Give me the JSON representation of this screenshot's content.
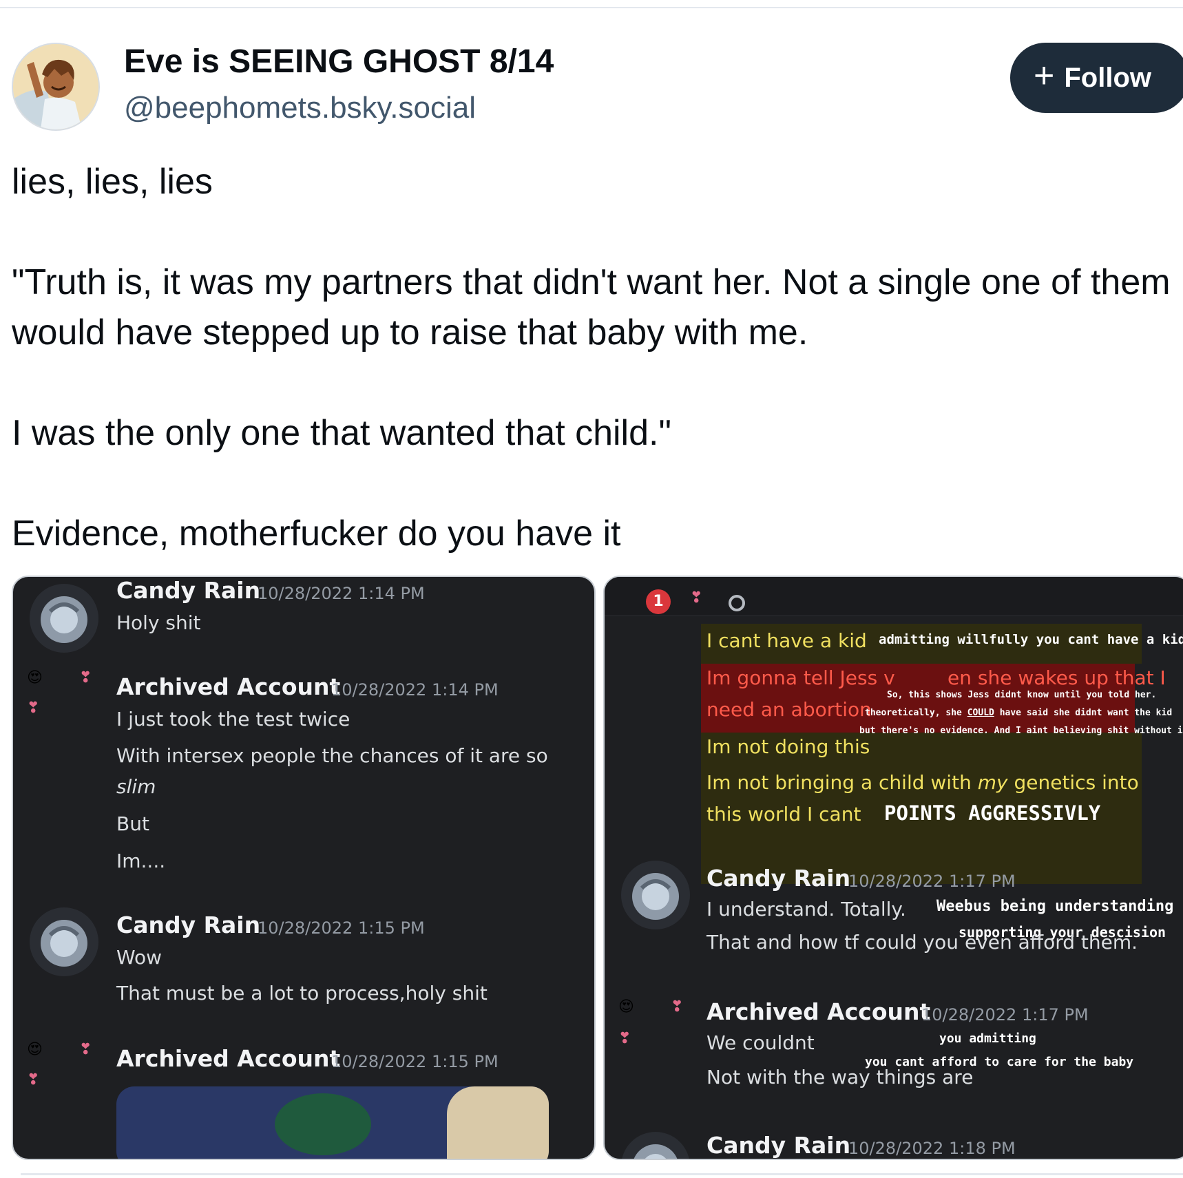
{
  "post": {
    "display_name": "Eve is SEEING GHOST 8/14",
    "handle": "@beephomets.bsky.social",
    "follow_label": "Follow",
    "text": "lies, lies, lies\n\n\"Truth is, it was my partners that didn't want her. Not a single one of them would have stepped up to raise that baby with me.\n\nI was the only one that wanted that child.\"\n\nEvidence, motherfucker do you have it"
  },
  "left_shot": {
    "messages": [
      {
        "user": "Candy Rain",
        "time": "10/28/2022 1:14 PM",
        "lines": [
          "Holy shit"
        ]
      },
      {
        "user": "Archived Account",
        "time": "10/28/2022 1:14 PM",
        "lines": [
          "I just took the test twice",
          "With intersex people the chances of it are so",
          "slim",
          "But",
          "Im...."
        ]
      },
      {
        "user": "Candy Rain",
        "time": "10/28/2022 1:15 PM",
        "lines": [
          "Wow",
          "That must be a lot to process,holy shit"
        ]
      },
      {
        "user": "Archived Account",
        "time": "10/28/2022 1:15 PM",
        "lines": []
      }
    ]
  },
  "right_shot": {
    "badge": "1",
    "highlighted_lines": [
      "I cant have a kid",
      "Im gonna tell Jess v",
      "en she wakes up that I",
      "need an abortion",
      "Im not doing this",
      "Im not bringing a child with",
      "my",
      "genetics into",
      "this world I cant"
    ],
    "annotations": [
      "admitting willfully you cant have a kid",
      "So, this shows Jess didnt know until you told her.",
      "theoretically, she",
      "COULD",
      "have said she didnt want the kid",
      "but there's no evidence. And I aint believing shit without it.",
      "POINTS AGGRESSIVLY",
      "Weebus being understanding &",
      "supporting your descision",
      "you admitting",
      "you cant afford to care for the baby"
    ],
    "messages": [
      {
        "user": "Candy Rain",
        "time": "10/28/2022 1:17 PM",
        "lines": [
          "I understand. Totally.",
          "That and how tf could you even afford them."
        ]
      },
      {
        "user": "Archived Account",
        "time": "10/28/2022 1:17 PM",
        "lines": [
          "We couldnt",
          "Not with the way things are"
        ]
      },
      {
        "user": "Candy Rain",
        "time": "10/28/2022 1:18 PM",
        "lines": []
      }
    ]
  },
  "colors": {
    "follow_bg": "#1e2c3a",
    "discord_bg": "#1e1f22",
    "highlight_yellow": "#2e2c10",
    "highlight_red": "#6b1010",
    "highlight_text": "#f0e060"
  },
  "icons": [
    "heart-eyes-icon",
    "hearts-icon",
    "notification-badge",
    "plus-icon"
  ]
}
